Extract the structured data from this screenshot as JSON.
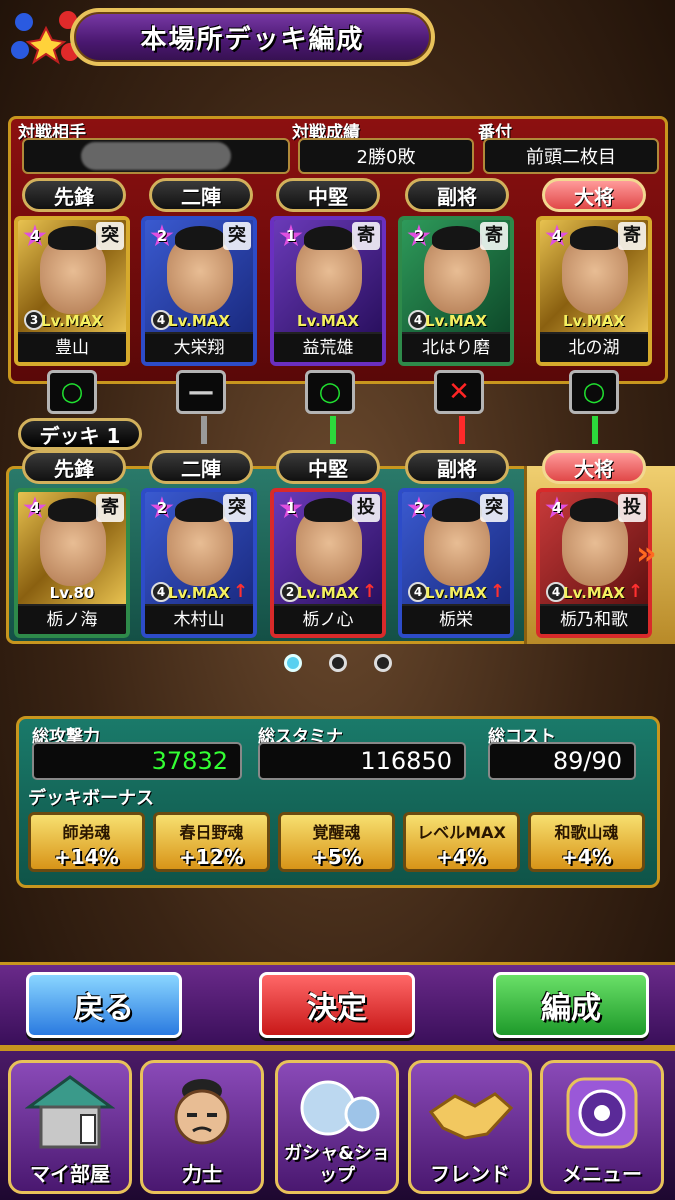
{
  "header": {
    "title": "本場所デッキ編成"
  },
  "opponent": {
    "label_opponent": "対戦相手",
    "label_record": "対戦成績",
    "record": "2勝0敗",
    "label_rank": "番付",
    "rank": "前頭二枚目",
    "positions": [
      "先鋒",
      "二陣",
      "中堅",
      "副将",
      "大将"
    ],
    "wrestlers": [
      {
        "name": "豊山",
        "stars": "4",
        "type": "突",
        "level": "Lv.MAX",
        "badge": "3"
      },
      {
        "name": "大栄翔",
        "stars": "2",
        "type": "突",
        "level": "Lv.MAX",
        "badge": "4"
      },
      {
        "name": "益荒雄",
        "stars": "1",
        "type": "寄",
        "level": "Lv.MAX",
        "badge": ""
      },
      {
        "name": "北はり磨",
        "stars": "2",
        "type": "寄",
        "level": "Lv.MAX",
        "badge": "4"
      },
      {
        "name": "北の湖",
        "stars": "4",
        "type": "寄",
        "level": "Lv.MAX",
        "badge": ""
      }
    ]
  },
  "results": [
    "win",
    "draw",
    "win",
    "loss",
    "win"
  ],
  "result_symbols": {
    "win": "○",
    "draw": "—",
    "loss": "✕"
  },
  "deck": {
    "label": "デッキ 1",
    "positions": [
      "先鋒",
      "二陣",
      "中堅",
      "副将",
      "大将"
    ],
    "wrestlers": [
      {
        "name": "栃ノ海",
        "stars": "4",
        "type": "寄",
        "level": "Lv.80",
        "badge": ""
      },
      {
        "name": "木村山",
        "stars": "2",
        "type": "突",
        "level": "Lv.MAX",
        "badge": "4"
      },
      {
        "name": "栃ノ心",
        "stars": "1",
        "type": "投",
        "level": "Lv.MAX",
        "badge": "2"
      },
      {
        "name": "栃栄",
        "stars": "2",
        "type": "突",
        "level": "Lv.MAX",
        "badge": "4"
      },
      {
        "name": "栃乃和歌",
        "stars": "4",
        "type": "投",
        "level": "Lv.MAX",
        "badge": "4"
      }
    ]
  },
  "pagination": {
    "count": 3,
    "active": 0
  },
  "stats": {
    "attack_label": "総攻撃力",
    "attack": "37832",
    "stamina_label": "総スタミナ",
    "stamina": "116850",
    "cost_label": "総コスト",
    "cost": "89/90"
  },
  "bonus": {
    "title": "デッキボーナス",
    "items": [
      {
        "name": "師弟魂",
        "value": "+14%"
      },
      {
        "name": "春日野魂",
        "value": "+12%"
      },
      {
        "name": "覚醒魂",
        "value": "+5%"
      },
      {
        "name": "レベルMAX",
        "value": "+4%"
      },
      {
        "name": "和歌山魂",
        "value": "+4%"
      }
    ]
  },
  "actions": {
    "back": "戻る",
    "decide": "決定",
    "edit": "編成"
  },
  "nav": [
    {
      "label": "マイ部屋",
      "icon": "house-icon"
    },
    {
      "label": "力士",
      "icon": "wrestler-icon"
    },
    {
      "label": "ガシャ&ショップ",
      "icon": "gacha-icon"
    },
    {
      "label": "フレンド",
      "icon": "handshake-icon"
    },
    {
      "label": "メニュー",
      "icon": "crest-icon"
    }
  ]
}
